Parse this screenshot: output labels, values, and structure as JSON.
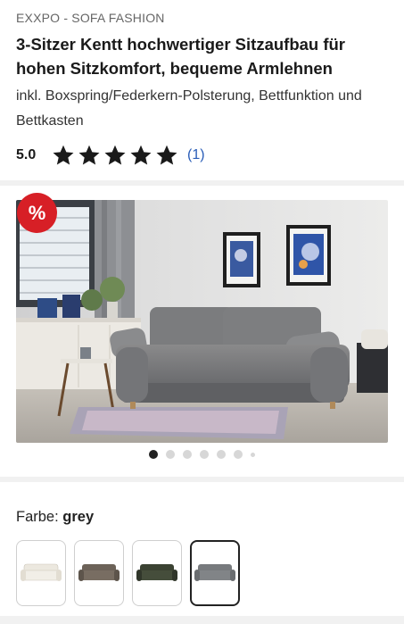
{
  "product": {
    "brand": "EXXPO - SOFA FASHION",
    "title": "3-Sitzer Kentt hochwertiger Sitzaufbau für hohen Sitzkomfort, bequeme Armlehnen",
    "subtitle": "inkl. Boxspring/Federkern-Polsterung, Bettfunktion und Bettkasten"
  },
  "rating": {
    "value": "5.0",
    "stars": 5,
    "count_label": "(1)",
    "star_color": "#1a1a1a"
  },
  "badge": {
    "label": "%",
    "color": "#d71f26"
  },
  "gallery": {
    "image_icon": "sofa-product-photo",
    "dots_total": 7,
    "active_index": 0
  },
  "color_selector": {
    "label": "Farbe:",
    "selected": "grey",
    "options": [
      {
        "name": "cream",
        "color": "#ece8df"
      },
      {
        "name": "brown",
        "color": "#6c6258"
      },
      {
        "name": "dark-green",
        "color": "#3b4232"
      },
      {
        "name": "grey",
        "color": "#777a7d"
      }
    ]
  }
}
